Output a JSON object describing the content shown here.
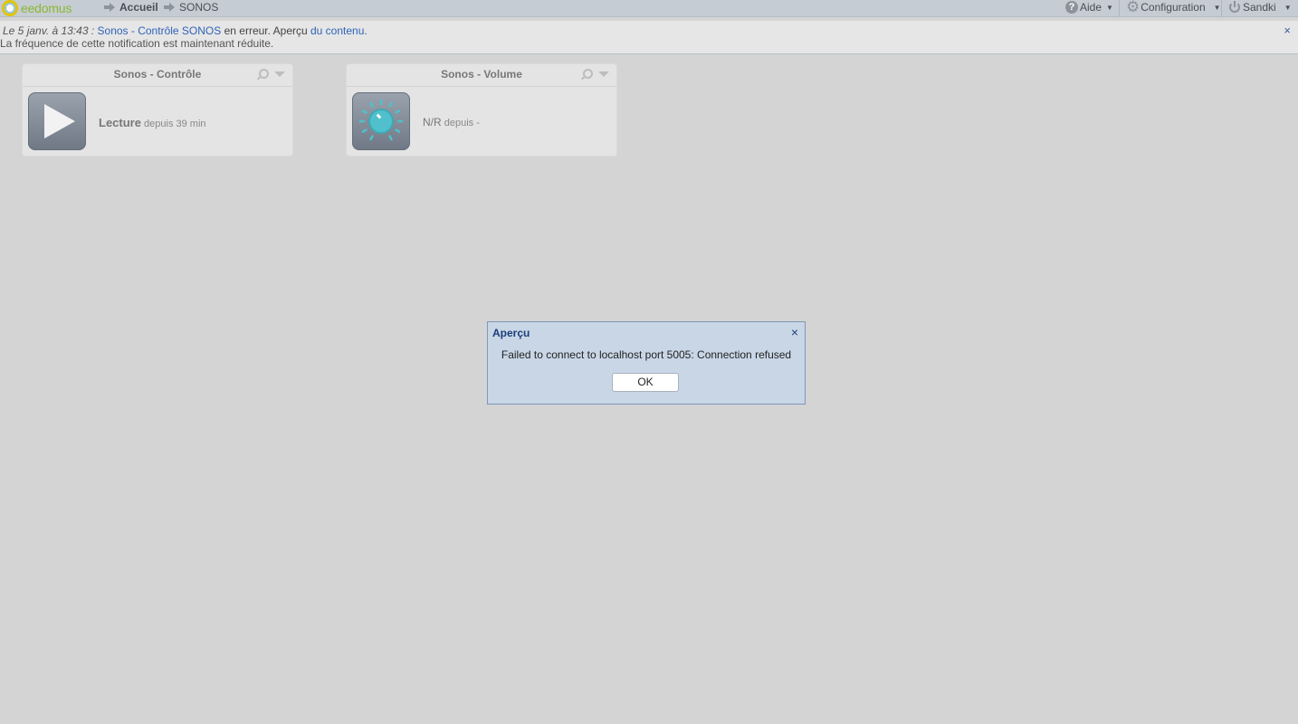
{
  "topbar": {
    "logo_text": "eedomus",
    "breadcrumb": [
      {
        "label": "Accueil"
      },
      {
        "label": "SONOS"
      }
    ],
    "menu": {
      "help": "Aide",
      "config": "Configuration",
      "user": "Sandki"
    }
  },
  "notification": {
    "timestamp": "Le 5 janv. à 13:43 :",
    "device_link": "Sonos - Contrôle SONOS",
    "text_mid": " en erreur. Aperçu ",
    "content_link": "du contenu.",
    "line2": "La fréquence de cette notification est maintenant réduite.",
    "close": "×"
  },
  "widgets": [
    {
      "title": "Sonos - Contrôle",
      "value": "Lecture",
      "since": "depuis 39 min",
      "icon": "play-icon"
    },
    {
      "title": "Sonos - Volume",
      "value": "N/R",
      "since": "depuis -",
      "icon": "volume-knob-icon"
    }
  ],
  "dialog": {
    "title": "Aperçu",
    "message": "Failed to connect to localhost port 5005: Connection refused",
    "ok_label": "OK",
    "close": "×"
  },
  "colors": {
    "background": "#d4d4d4",
    "dialog_bg": "#c8d6e6",
    "link": "#2f63b8",
    "logo_green": "#8ab833"
  }
}
